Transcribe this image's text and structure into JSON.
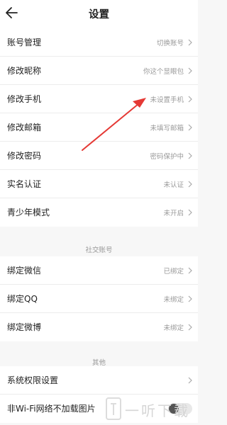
{
  "header": {
    "title": "设置",
    "back_icon": "arrow-left-icon"
  },
  "account_rows": [
    {
      "label": "账号管理",
      "value": "切换账号"
    },
    {
      "label": "修改昵称",
      "value": "你这个显眼包"
    },
    {
      "label": "修改手机",
      "value": "未设置手机"
    },
    {
      "label": "修改邮箱",
      "value": "未填写邮箱"
    },
    {
      "label": "修改密码",
      "value": "密码保护中"
    },
    {
      "label": "实名认证",
      "value": "未认证"
    },
    {
      "label": "青少年模式",
      "value": "未开启"
    }
  ],
  "social_section": {
    "title": "社交账号",
    "rows": [
      {
        "label": "绑定微信",
        "value": "已绑定"
      },
      {
        "label": "绑定QQ",
        "value": "未绑定"
      },
      {
        "label": "绑定微博",
        "value": "未绑定"
      }
    ]
  },
  "other_section": {
    "title": "其他",
    "rows": [
      {
        "label": "系统权限设置"
      },
      {
        "label": "非Wi-Fi网络不加载图片",
        "toggle_on": false
      }
    ]
  },
  "watermark": {
    "text": "一听下载"
  },
  "colors": {
    "annotation_arrow": "#e53935"
  }
}
